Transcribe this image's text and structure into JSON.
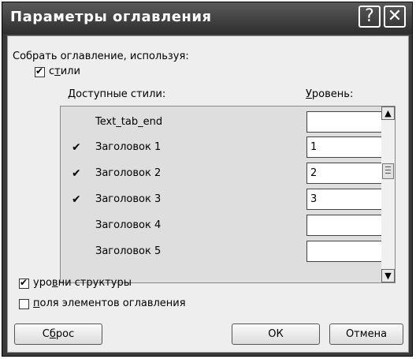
{
  "dialog": {
    "title": "Параметры оглавления",
    "help_label": "?",
    "close_label": "✕"
  },
  "build_label": "Собрать оглавление, используя:",
  "styles_checkbox": {
    "label_pre": "с",
    "label_u": "т",
    "label_post": "или",
    "checked": true
  },
  "columns": {
    "available_styles": "Доступные стили:",
    "level_u": "У",
    "level_post": "ровень:"
  },
  "rows": [
    {
      "check": "",
      "name": "Text_tab_end",
      "level": ""
    },
    {
      "check": "✔",
      "name": "Заголовок 1",
      "level": "1"
    },
    {
      "check": "✔",
      "name": "Заголовок 2",
      "level": "2"
    },
    {
      "check": "✔",
      "name": "Заголовок 3",
      "level": "3"
    },
    {
      "check": "",
      "name": "Заголовок 4",
      "level": ""
    },
    {
      "check": "",
      "name": "Заголовок 5",
      "level": ""
    }
  ],
  "outline_checkbox": {
    "label_pre": "уро",
    "label_u": "в",
    "label_post": "ни структуры",
    "checked": true
  },
  "fields_checkbox": {
    "label_pre": "",
    "label_u": "п",
    "label_post": "оля элементов оглавления",
    "checked": false
  },
  "buttons": {
    "reset_pre": "С",
    "reset_u": "б",
    "reset_post": "рос",
    "ok": "ОК",
    "cancel": "Отмена"
  },
  "scroll_icons": {
    "up": "▲",
    "down": "▼"
  }
}
